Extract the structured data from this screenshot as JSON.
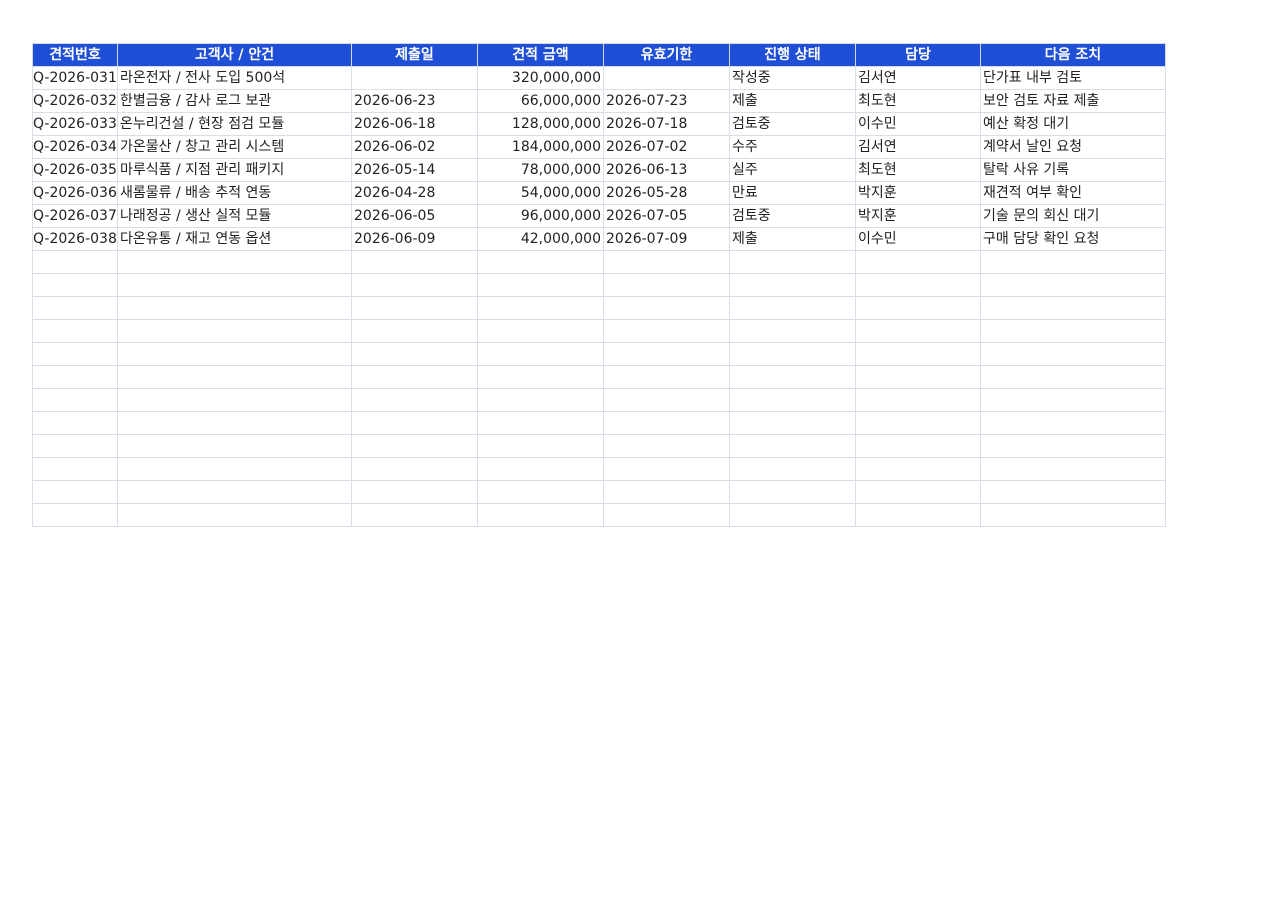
{
  "sheet": {
    "headers": [
      "견적번호",
      "고객사 / 안건",
      "제출일",
      "견적 금액",
      "유효기한",
      "진행 상태",
      "담당",
      "다음 조치"
    ],
    "rows": [
      [
        "Q-2026-031",
        "라온전자 / 전사 도입 500석",
        "",
        "320,000,000",
        "",
        "작성중",
        "김서연",
        "단가표 내부 검토"
      ],
      [
        "Q-2026-032",
        "한별금융 / 감사 로그 보관",
        "2026-06-23",
        "66,000,000",
        "2026-07-23",
        "제출",
        "최도현",
        "보안 검토 자료 제출"
      ],
      [
        "Q-2026-033",
        "온누리건설 / 현장 점검 모듈",
        "2026-06-18",
        "128,000,000",
        "2026-07-18",
        "검토중",
        "이수민",
        "예산 확정 대기"
      ],
      [
        "Q-2026-034",
        "가온물산 / 창고 관리 시스템",
        "2026-06-02",
        "184,000,000",
        "2026-07-02",
        "수주",
        "김서연",
        "계약서 날인 요청"
      ],
      [
        "Q-2026-035",
        "마루식품 / 지점 관리 패키지",
        "2026-05-14",
        "78,000,000",
        "2026-06-13",
        "실주",
        "최도현",
        "탈락 사유 기록"
      ],
      [
        "Q-2026-036",
        "새롬물류 / 배송 추적 연동",
        "2026-04-28",
        "54,000,000",
        "2026-05-28",
        "만료",
        "박지훈",
        "재견적 여부 확인"
      ],
      [
        "Q-2026-037",
        "나래정공 / 생산 실적 모듈",
        "2026-06-05",
        "96,000,000",
        "2026-07-05",
        "검토중",
        "박지훈",
        "기술 문의 회신 대기"
      ],
      [
        "Q-2026-038",
        "다온유통 / 재고 연동 옵션",
        "2026-06-09",
        "42,000,000",
        "2026-07-09",
        "제출",
        "이수민",
        "구매 담당 확인 요청"
      ]
    ],
    "empty_row_count": 12,
    "colors": {
      "header_bg": "#1f4fd6",
      "header_text": "#ffffff",
      "grid": "#d9dee8"
    }
  }
}
